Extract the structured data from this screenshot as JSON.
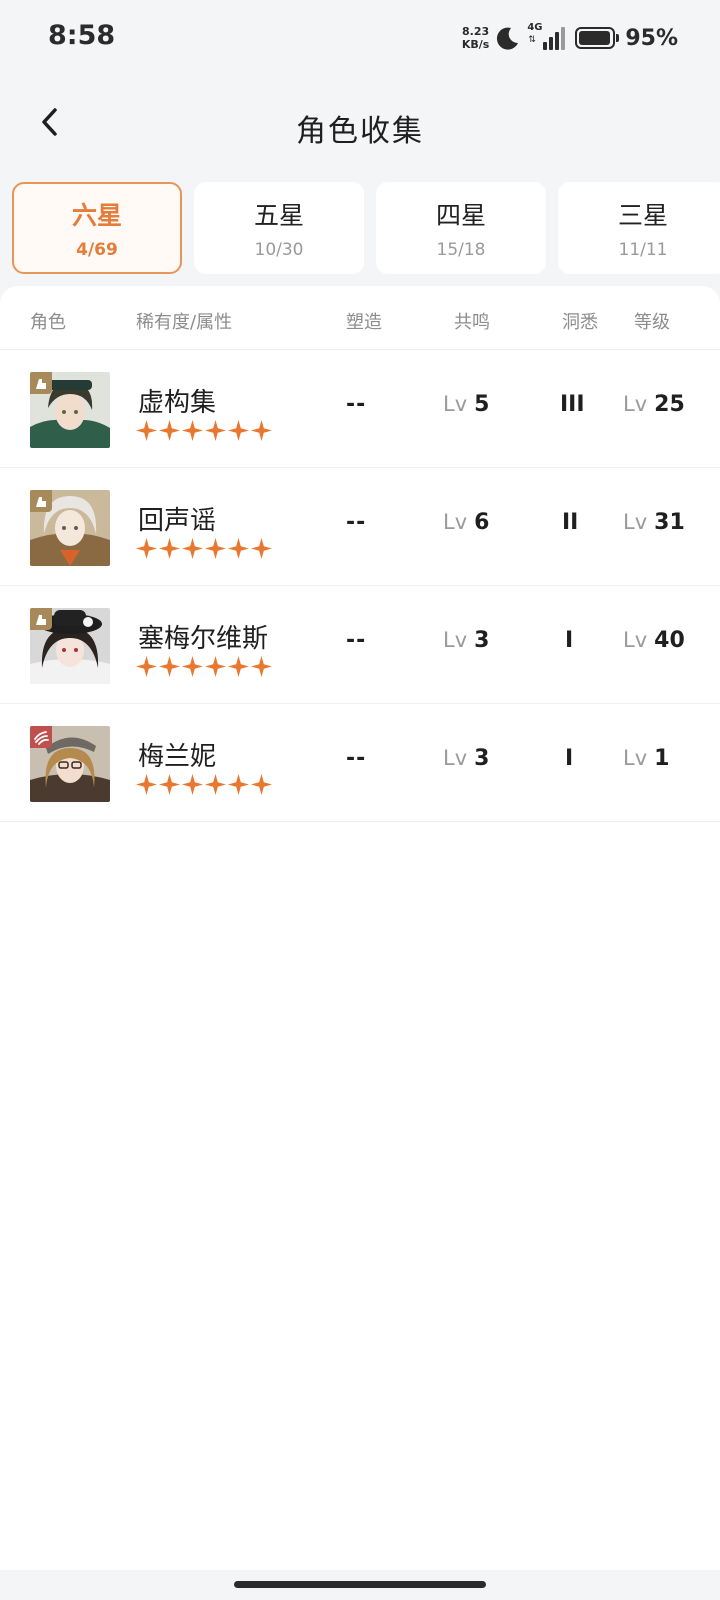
{
  "status": {
    "time": "8:58",
    "net_speed_value": "8.23",
    "net_speed_unit": "KB/s",
    "network": "4G",
    "battery_percent": "95%"
  },
  "header": {
    "title": "角色收集"
  },
  "tabs": [
    {
      "label": "六星",
      "count": "4/69",
      "active": true
    },
    {
      "label": "五星",
      "count": "10/30",
      "active": false
    },
    {
      "label": "四星",
      "count": "15/18",
      "active": false
    },
    {
      "label": "三星",
      "count": "11/11",
      "active": false
    }
  ],
  "table": {
    "columns": {
      "character": "角色",
      "rarity": "稀有度/属性",
      "shaping": "塑造",
      "resonance": "共鸣",
      "insight": "洞悉",
      "level": "等级"
    },
    "lv_prefix": "Lv",
    "rows": [
      {
        "name": "虚构集",
        "stars": 6,
        "shaping": "--",
        "resonance": "5",
        "insight": "III",
        "level": "25",
        "badge_icon": "tower-icon",
        "badge_color": "#a88a5a"
      },
      {
        "name": "回声谣",
        "stars": 6,
        "shaping": "--",
        "resonance": "6",
        "insight": "II",
        "level": "31",
        "badge_icon": "tower-icon",
        "badge_color": "#a88a5a"
      },
      {
        "name": "塞梅尔维斯",
        "stars": 6,
        "shaping": "--",
        "resonance": "3",
        "insight": "I",
        "level": "40",
        "badge_icon": "tower-icon",
        "badge_color": "#a88a5a"
      },
      {
        "name": "梅兰妮",
        "stars": 6,
        "shaping": "--",
        "resonance": "3",
        "insight": "I",
        "level": "1",
        "badge_icon": "claw-icon",
        "badge_color": "#c0504d"
      }
    ]
  },
  "colors": {
    "accent": "#e47c3a",
    "star": "#e8782f"
  }
}
